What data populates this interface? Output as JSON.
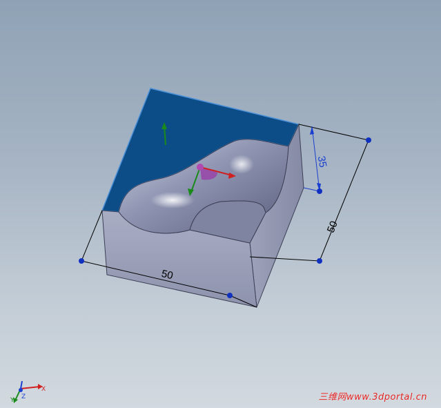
{
  "model": {
    "dimensions": {
      "width": "50",
      "depth": "50",
      "height": "35"
    }
  },
  "triad": {
    "x": "X",
    "y": "Y",
    "z": "Z"
  },
  "watermark": {
    "text": "三维网www.3dportal.cn"
  },
  "colors": {
    "top_face": "#0d4d87",
    "top_face_edge": "#4a90d8",
    "side_face": "#8d93b0",
    "dimension_text": "#000000",
    "dimension_text_blue": "#1a3fd0",
    "handle_point": "#1030c0"
  }
}
